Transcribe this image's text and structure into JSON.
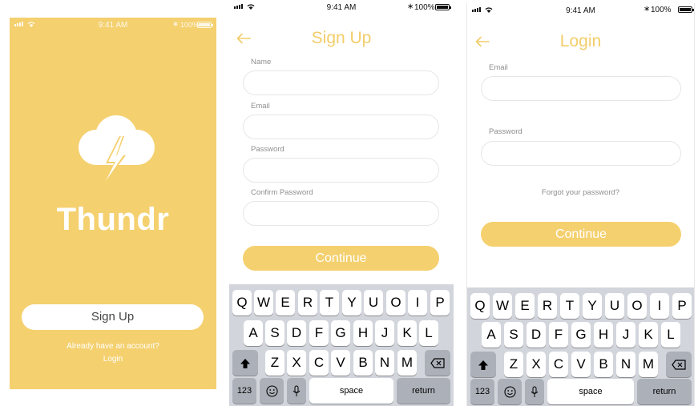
{
  "status_bar": {
    "time": "9:41 AM",
    "battery": "100%"
  },
  "splash": {
    "app_name": "Thundr",
    "signup_button": "Sign Up",
    "already_text": "Already have an account?",
    "login_link": "Login"
  },
  "signup": {
    "title": "Sign Up",
    "fields": [
      {
        "label": "Name",
        "value": ""
      },
      {
        "label": "Email",
        "value": ""
      },
      {
        "label": "Password",
        "value": ""
      },
      {
        "label": "Confirm Password",
        "value": ""
      }
    ],
    "continue_label": "Continue"
  },
  "login": {
    "title": "Login",
    "fields": [
      {
        "label": "Email",
        "value": ""
      },
      {
        "label": "Password",
        "value": ""
      }
    ],
    "forgot_link": "Forgot your password?",
    "continue_label": "Continue"
  },
  "keyboard": {
    "row1": [
      "Q",
      "W",
      "E",
      "R",
      "T",
      "Y",
      "U",
      "O",
      "I",
      "P"
    ],
    "row2": [
      "A",
      "S",
      "D",
      "F",
      "G",
      "H",
      "J",
      "K",
      "L"
    ],
    "row3": [
      "Z",
      "X",
      "C",
      "V",
      "B",
      "N",
      "M"
    ],
    "numbers_key": "123",
    "space_key": "space",
    "return_key": "return",
    "icons": [
      "shift-icon",
      "backspace-icon",
      "emoji-icon",
      "microphone-icon"
    ]
  },
  "colors": {
    "brand_yellow": "#f4d06f",
    "title_yellow": "#f2cd69",
    "keyboard_bg": "#d2d5db",
    "dark_key": "#acb1b9"
  }
}
